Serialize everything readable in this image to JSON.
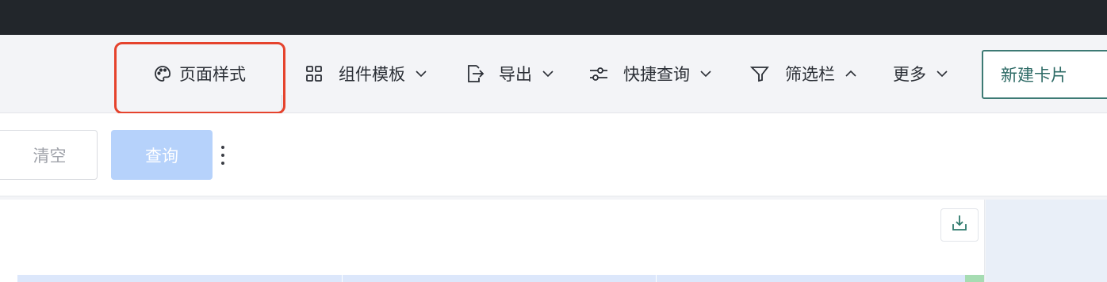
{
  "toolbar": {
    "page_style": "页面样式",
    "component_template": "组件模板",
    "export": "导出",
    "quick_query": "快捷查询",
    "filter_bar": "筛选栏",
    "more": "更多",
    "new_card": "新建卡片"
  },
  "filter": {
    "clear": "清空",
    "query": "查询"
  },
  "icons": {
    "page_style": "palette-icon",
    "component_template": "grid-icon",
    "export": "export-icon",
    "quick_query": "sliders-icon",
    "filter_bar": "filter-icon",
    "download": "download-icon"
  },
  "colors": {
    "topbar": "#22262b",
    "highlight": "#e5432d",
    "primary_disabled": "#b6d2fb",
    "new_card_border": "#3d7a74"
  }
}
